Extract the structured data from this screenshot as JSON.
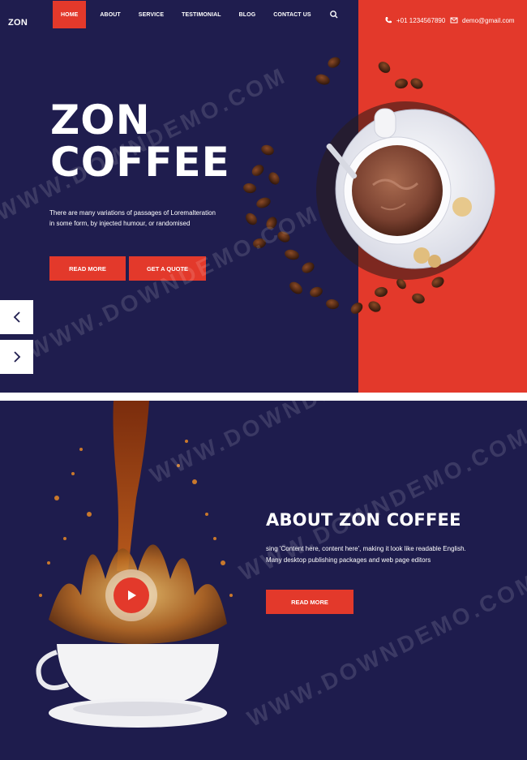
{
  "brand": {
    "logo": "ZON"
  },
  "nav": {
    "items": [
      {
        "label": "HOME",
        "active": true
      },
      {
        "label": "ABOUT"
      },
      {
        "label": "SERVICE"
      },
      {
        "label": "TESTIMONIAL"
      },
      {
        "label": "BLOG"
      },
      {
        "label": "CONTACT US"
      }
    ],
    "search_icon": "search-icon"
  },
  "contact": {
    "phone": "+01 1234567890",
    "email": "demo@gmail.com",
    "phone_icon": "phone-icon",
    "email_icon": "mail-icon"
  },
  "hero": {
    "title_line1": "ZON",
    "title_line2": "COFFEE",
    "text": "There are many variations of passages of Loremalteration in some form, by injected humour, or randomised",
    "btn_read_more": "READ MORE",
    "btn_quote": "GET A QUOTE",
    "prev_icon": "chevron-left-icon",
    "next_icon": "chevron-right-icon"
  },
  "about": {
    "title": "ABOUT ZON COFFEE",
    "text": "sing 'Content here, content here', making it look like readable English. Many desktop publishing packages and web page editors",
    "btn_read_more": "READ MORE",
    "play_icon": "play-icon"
  },
  "watermark": "WWW.DOWNDEMO.COM",
  "colors": {
    "navy": "#1f1d4e",
    "accent": "#e3392b",
    "white": "#ffffff"
  }
}
